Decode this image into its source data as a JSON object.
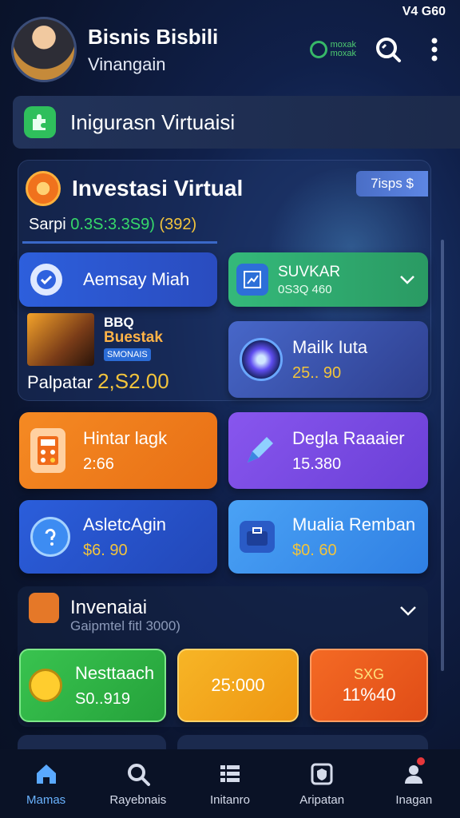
{
  "status": {
    "text": "V4 G60"
  },
  "header": {
    "user_name": "Bisnis Bisbili",
    "user_subtitle": "Vinangain",
    "brand_text_1": "moxak",
    "brand_text_2": "moxak",
    "icons": [
      "search-icon",
      "more-vertical-icon"
    ]
  },
  "section": {
    "title": "Inigurasn Virtuaisi",
    "icon": "puzzle-icon"
  },
  "panel": {
    "title": "Investasi Virtual",
    "tag": "7isps $",
    "balance_label": "Sarpi",
    "balance_value": "0.3S:3.3S9)",
    "balance_extra": "(392)"
  },
  "cards": {
    "card1": {
      "label": "Aemsay Miah",
      "color": "#2f60d8"
    },
    "card2": {
      "label": "SUVKAR",
      "value": "0S3Q 460",
      "color": "#2ea66a"
    },
    "promo": {
      "tag1": "BBQ",
      "tag2": "Buestak",
      "tag3": "SMONAIS",
      "label": "Palpatar",
      "value": "2,S2.00"
    },
    "card4": {
      "label": "Mailk Iuta",
      "value": "25.. 90",
      "color": "#3b58b8"
    },
    "card5": {
      "label": "Hintar lagk",
      "value": "2:66",
      "color": "#f07d1c"
    },
    "card6": {
      "label": "Degla Raaaier",
      "value": "15.380",
      "color": "#7b4ee0"
    },
    "card7": {
      "label": "AsletcAgin",
      "value": "$6. 90",
      "color": "#2a56d2"
    },
    "card8": {
      "label": "Mualia Remban",
      "value": "$0. 60",
      "color": "#3d8df0"
    }
  },
  "investment": {
    "title": "Invenaiai",
    "subtitle": "Gaipmtel fitl 3000)",
    "tiles": [
      {
        "label": "Nesttaach",
        "value": "S0..919",
        "color": "#2fb949"
      },
      {
        "label": "",
        "value": "25:000",
        "color": "#f3a51c"
      },
      {
        "label": "SXG",
        "value": "11%40",
        "color": "#ef5a1e"
      }
    ]
  },
  "nav": {
    "items": [
      {
        "label": "Mamas",
        "icon": "home-icon"
      },
      {
        "label": "Rayebnais",
        "icon": "search-icon"
      },
      {
        "label": "Initanro",
        "icon": "list-icon"
      },
      {
        "label": "Aripatan",
        "icon": "shield-icon"
      },
      {
        "label": "Inagan",
        "icon": "profile-icon"
      }
    ]
  }
}
